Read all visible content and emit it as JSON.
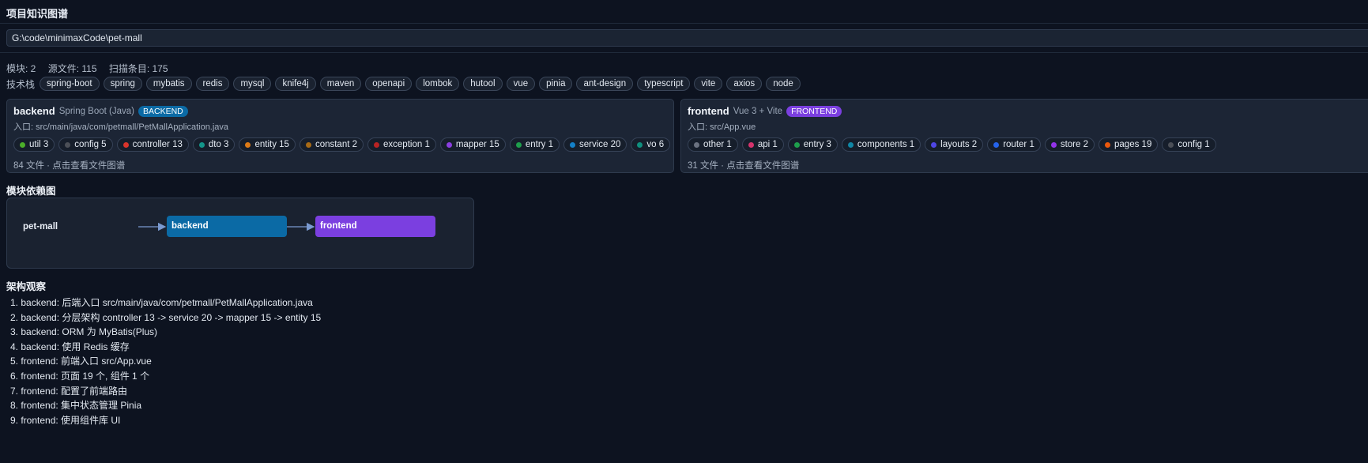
{
  "header": {
    "title": "项目知识图谱"
  },
  "path": {
    "value": "G:\\code\\minimaxCode\\pet-mall"
  },
  "stats": {
    "modules": "模块: 2",
    "sources": "源文件: 115",
    "scanned": "扫描条目: 175"
  },
  "tech": {
    "label": "技术栈",
    "items": [
      "spring-boot",
      "spring",
      "mybatis",
      "redis",
      "mysql",
      "knife4j",
      "maven",
      "openapi",
      "lombok",
      "hutool",
      "vue",
      "pinia",
      "ant-design",
      "typescript",
      "vite",
      "axios",
      "node"
    ]
  },
  "modules": [
    {
      "name": "backend",
      "framework": "Spring Boot (Java)",
      "badge": "BACKEND",
      "entry": "入口: src/main/java/com/petmall/PetMallApplication.java",
      "categories": [
        {
          "label": "util 3",
          "color": "#4caf2a"
        },
        {
          "label": "config 5",
          "color": "#4b4f57"
        },
        {
          "label": "controller 13",
          "color": "#d9342b"
        },
        {
          "label": "dto 3",
          "color": "#13968a"
        },
        {
          "label": "entity 15",
          "color": "#dd7a16"
        },
        {
          "label": "constant 2",
          "color": "#a86a15"
        },
        {
          "label": "exception 1",
          "color": "#b82323"
        },
        {
          "label": "mapper 15",
          "color": "#8a3ee0"
        },
        {
          "label": "entry 1",
          "color": "#1e9e4c"
        },
        {
          "label": "service 20",
          "color": "#1380c8"
        },
        {
          "label": "vo 6",
          "color": "#0f8f7e"
        }
      ],
      "files": "84 文件 · 点击查看文件图谱"
    },
    {
      "name": "frontend",
      "framework": "Vue 3 + Vite",
      "badge": "FRONTEND",
      "entry": "入口: src/App.vue",
      "categories": [
        {
          "label": "other 1",
          "color": "#6b7280"
        },
        {
          "label": "api 1",
          "color": "#d6336c"
        },
        {
          "label": "entry 3",
          "color": "#1e9e4c"
        },
        {
          "label": "components 1",
          "color": "#0f87a6"
        },
        {
          "label": "layouts 2",
          "color": "#4f46e5"
        },
        {
          "label": "router 1",
          "color": "#2563eb"
        },
        {
          "label": "store 2",
          "color": "#9333ea"
        },
        {
          "label": "pages 19",
          "color": "#ea580c"
        },
        {
          "label": "config 1",
          "color": "#4b4f57"
        }
      ],
      "files": "31 文件 · 点击查看文件图谱"
    }
  ],
  "deps": {
    "title": "模块依赖图",
    "root": "pet-mall",
    "nodes": [
      "backend",
      "frontend"
    ]
  },
  "observations": {
    "title": "架构观察",
    "items": [
      "1. backend: 后端入口 src/main/java/com/petmall/PetMallApplication.java",
      "2. backend: 分层架构 controller 13 -> service 20 -> mapper 15 -> entity 15",
      "3. backend: ORM 为 MyBatis(Plus)",
      "4. backend: 使用 Redis 缓存",
      "5. frontend: 前端入口 src/App.vue",
      "6. frontend: 页面 19 个, 组件 1 个",
      "7. frontend: 配置了前端路由",
      "8. frontend: 集中状态管理 Pinia",
      "9. frontend: 使用组件库 UI"
    ]
  }
}
